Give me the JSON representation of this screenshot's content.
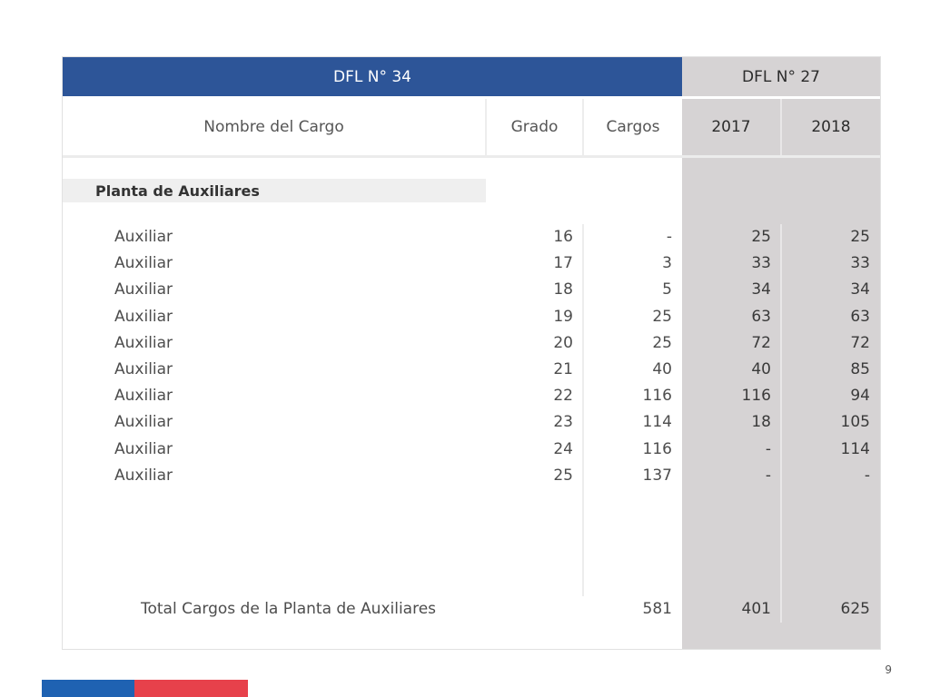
{
  "table": {
    "header_left": "DFL N° 34",
    "header_right": "DFL N° 27",
    "columns": {
      "name": "Nombre del Cargo",
      "grado": "Grado",
      "cargos": "Cargos",
      "y2017": "2017",
      "y2018": "2018"
    },
    "section_title": "Planta de Auxiliares",
    "rows": [
      {
        "name": "Auxiliar",
        "grado": "16",
        "cargos": "-",
        "y2017": "25",
        "y2018": "25"
      },
      {
        "name": "Auxiliar",
        "grado": "17",
        "cargos": "3",
        "y2017": "33",
        "y2018": "33"
      },
      {
        "name": "Auxiliar",
        "grado": "18",
        "cargos": "5",
        "y2017": "34",
        "y2018": "34"
      },
      {
        "name": "Auxiliar",
        "grado": "19",
        "cargos": "25",
        "y2017": "63",
        "y2018": "63"
      },
      {
        "name": "Auxiliar",
        "grado": "20",
        "cargos": "25",
        "y2017": "72",
        "y2018": "72"
      },
      {
        "name": "Auxiliar",
        "grado": "21",
        "cargos": "40",
        "y2017": "40",
        "y2018": "85"
      },
      {
        "name": "Auxiliar",
        "grado": "22",
        "cargos": "116",
        "y2017": "116",
        "y2018": "94"
      },
      {
        "name": "Auxiliar",
        "grado": "23",
        "cargos": "114",
        "y2017": "18",
        "y2018": "105"
      },
      {
        "name": "Auxiliar",
        "grado": "24",
        "cargos": "116",
        "y2017": "-",
        "y2018": "114"
      },
      {
        "name": "Auxiliar",
        "grado": "25",
        "cargos": "137",
        "y2017": "-",
        "y2018": "-"
      }
    ],
    "total": {
      "label": "Total Cargos de la Planta de Auxiliares",
      "cargos": "581",
      "y2017": "401",
      "y2018": "625"
    }
  },
  "page_number": "9",
  "colors": {
    "header_blue": "#2d5598",
    "panel_grey": "#d6d3d4",
    "flag_blue": "#1f62b2",
    "flag_red": "#e7414b"
  }
}
